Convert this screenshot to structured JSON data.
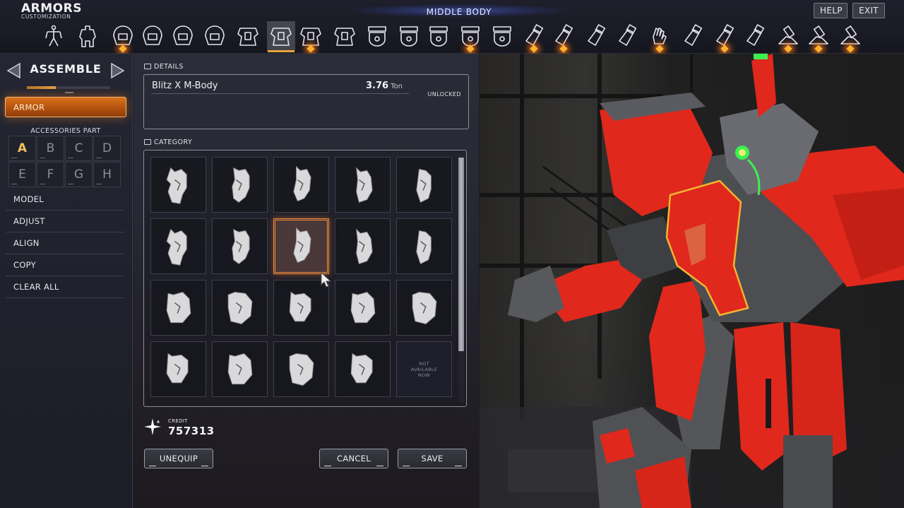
{
  "header": {
    "title": "ARMORS",
    "subtitle": "CUSTOMIZATION",
    "section": "MIDDLE BODY",
    "help_label": "HELP",
    "exit_label": "EXIT"
  },
  "part_strip": {
    "selected_index": 7,
    "items": [
      {
        "icon": "skeleton-icon",
        "marker": false
      },
      {
        "icon": "full-body-icon",
        "marker": false
      },
      {
        "icon": "helmet-icon",
        "marker": true
      },
      {
        "icon": "head-visor-icon",
        "marker": false
      },
      {
        "icon": "head-mask-icon",
        "marker": false
      },
      {
        "icon": "neck-icon",
        "marker": false
      },
      {
        "icon": "upper-body-icon",
        "marker": false
      },
      {
        "icon": "middle-body-icon",
        "marker": false
      },
      {
        "icon": "chest-core-icon",
        "marker": true
      },
      {
        "icon": "back-plate-icon",
        "marker": false
      },
      {
        "icon": "waist-icon",
        "marker": false
      },
      {
        "icon": "waist-left-icon",
        "marker": false
      },
      {
        "icon": "waist-center-icon",
        "marker": false
      },
      {
        "icon": "waist-right-icon",
        "marker": true
      },
      {
        "icon": "hip-icon",
        "marker": false
      },
      {
        "icon": "shoulder-icon",
        "marker": true
      },
      {
        "icon": "upper-arm-icon",
        "marker": true
      },
      {
        "icon": "elbow-icon",
        "marker": false
      },
      {
        "icon": "forearm-icon",
        "marker": false
      },
      {
        "icon": "hand-icon",
        "marker": true
      },
      {
        "icon": "thigh-icon",
        "marker": false
      },
      {
        "icon": "knee-icon",
        "marker": true
      },
      {
        "icon": "shin-icon",
        "marker": false
      },
      {
        "icon": "ankle-icon",
        "marker": true
      },
      {
        "icon": "foot-icon",
        "marker": true
      },
      {
        "icon": "toe-icon",
        "marker": true
      }
    ]
  },
  "sidebar": {
    "mode_label": "ASSEMBLE",
    "mode_progress": 0.35,
    "armor_label": "ARMOR",
    "accessories_title": "ACCESSORIES PART",
    "accessories": [
      "A",
      "B",
      "C",
      "D",
      "E",
      "F",
      "G",
      "H"
    ],
    "accessories_active": "A",
    "menu": [
      {
        "label": "MODEL"
      },
      {
        "label": "ADJUST"
      },
      {
        "label": "ALIGN"
      },
      {
        "label": "COPY"
      },
      {
        "label": "CLEAR ALL"
      }
    ]
  },
  "details": {
    "section_label": "DETAILS",
    "part_name": "Blitz X M-Body",
    "weight": "3.76",
    "weight_unit": "Ton",
    "status": "UNLOCKED"
  },
  "category": {
    "section_label": "CATEGORY",
    "selected_index": 7,
    "unavailable_text": "NOT AVAILABLE NOW",
    "items_count": 20,
    "unavailable_index": 19,
    "scroll_fraction_visible": 0.8
  },
  "footer": {
    "credit_label": "CREDIT",
    "credit_value": "757313",
    "unequip_label": "UNEQUIP",
    "cancel_label": "CANCEL",
    "save_label": "SAVE"
  },
  "colors": {
    "accent_orange": "#e8a33a",
    "selection_orange": "#f08a3a",
    "mech_red": "#e0281c",
    "eye_green": "#3cf050",
    "outline_yellow": "#f2b530"
  }
}
